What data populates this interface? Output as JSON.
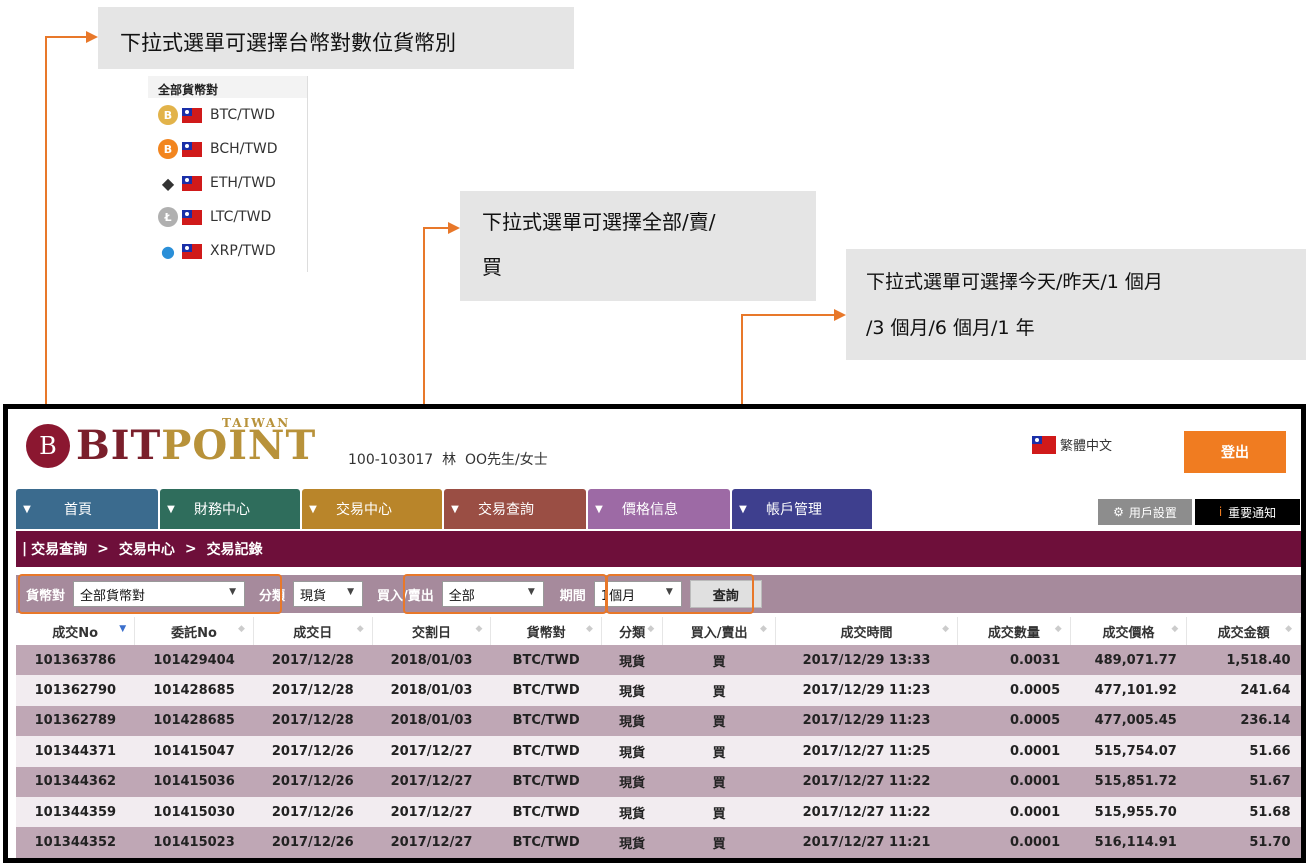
{
  "callouts": {
    "currency": "下拉式選單可選擇台幣對數位貨幣別",
    "side_line1": "下拉式選單可選擇全部/賣/",
    "side_line2": "買",
    "period_line1": "下拉式選單可選擇今天/昨天/1 個月",
    "period_line2": "/3 個月/6 個月/1 年"
  },
  "dropdown_preview": {
    "header": "全部貨幣對",
    "items": [
      {
        "label": "BTC/TWD",
        "icon": "btc-gold-coin-icon",
        "color": "#e2b34a"
      },
      {
        "label": "BCH/TWD",
        "icon": "bch-orange-coin-icon",
        "color": "#f2851f"
      },
      {
        "label": "ETH/TWD",
        "icon": "eth-diamond-icon",
        "color": "#333333"
      },
      {
        "label": "LTC/TWD",
        "icon": "ltc-silver-coin-icon",
        "color": "#b0b0b0"
      },
      {
        "label": "XRP/TWD",
        "icon": "xrp-icon",
        "color": "#2a8fd8"
      }
    ]
  },
  "header": {
    "logo_text": "BIT",
    "logo_text2": "POINT",
    "logo_sub": "TAIWAN",
    "user_info": "100-103017  林  OO先生/女士",
    "language": "繁體中文",
    "logout": "登出"
  },
  "nav": {
    "tabs": [
      {
        "label": "首頁",
        "color": "#3b6b8e",
        "width": 140
      },
      {
        "label": "財務中心",
        "color": "#2f6d5c",
        "width": 140
      },
      {
        "label": "交易中心",
        "color": "#b9852a",
        "width": 140
      },
      {
        "label": "交易查詢",
        "color": "#9a4e44",
        "width": 140
      },
      {
        "label": "價格信息",
        "color": "#9d6aa5",
        "width": 140
      },
      {
        "label": "帳戶管理",
        "color": "#3e3f8e",
        "width": 140
      }
    ],
    "user_settings": "用戶設置",
    "notice": "重要通知"
  },
  "breadcrumb": [
    "交易查詢",
    "交易中心",
    "交易記錄"
  ],
  "filters": {
    "pair_label": "貨幣對",
    "pair_value": "全部貨幣對",
    "type_label": "分類",
    "type_value": "現貨",
    "side_label": "買入/賣出",
    "side_value": "全部",
    "period_label": "期間",
    "period_value": "1個月",
    "query": "查詢"
  },
  "table": {
    "headers": [
      "成交No",
      "委託No",
      "成交日",
      "交割日",
      "貨幣對",
      "分類",
      "買入/賣出",
      "成交時間",
      "成交數量",
      "成交價格",
      "成交金額"
    ],
    "rows": [
      [
        "101363786",
        "101429404",
        "2017/12/28",
        "2018/01/03",
        "BTC/TWD",
        "現貨",
        "買",
        "2017/12/29 13:33",
        "0.0031",
        "489,071.77",
        "1,518.40"
      ],
      [
        "101362790",
        "101428685",
        "2017/12/28",
        "2018/01/03",
        "BTC/TWD",
        "現貨",
        "買",
        "2017/12/29 11:23",
        "0.0005",
        "477,101.92",
        "241.64"
      ],
      [
        "101362789",
        "101428685",
        "2017/12/28",
        "2018/01/03",
        "BTC/TWD",
        "現貨",
        "買",
        "2017/12/29 11:23",
        "0.0005",
        "477,005.45",
        "236.14"
      ],
      [
        "101344371",
        "101415047",
        "2017/12/26",
        "2017/12/27",
        "BTC/TWD",
        "現貨",
        "買",
        "2017/12/27 11:25",
        "0.0001",
        "515,754.07",
        "51.66"
      ],
      [
        "101344362",
        "101415036",
        "2017/12/26",
        "2017/12/27",
        "BTC/TWD",
        "現貨",
        "買",
        "2017/12/27 11:22",
        "0.0001",
        "515,851.72",
        "51.67"
      ],
      [
        "101344359",
        "101415030",
        "2017/12/26",
        "2017/12/27",
        "BTC/TWD",
        "現貨",
        "買",
        "2017/12/27 11:22",
        "0.0001",
        "515,955.70",
        "51.68"
      ],
      [
        "101344352",
        "101415023",
        "2017/12/26",
        "2017/12/27",
        "BTC/TWD",
        "現貨",
        "買",
        "2017/12/27 11:21",
        "0.0001",
        "516,114.91",
        "51.70"
      ]
    ]
  },
  "colors": {
    "accent": "#e8782a",
    "breadcrumb": "#6e0f3a",
    "filter_bar": "#a68a9c",
    "row_odd": "#bfa7b5",
    "row_even": "#f2ecf0"
  }
}
